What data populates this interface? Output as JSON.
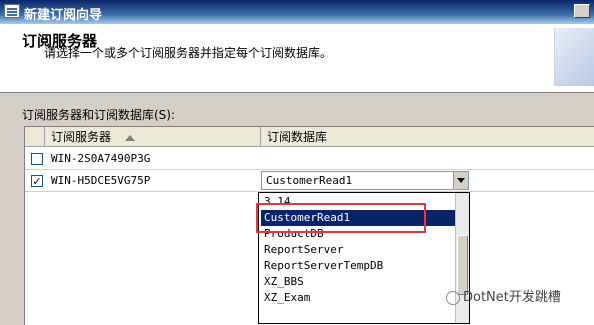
{
  "window": {
    "title": "新建订阅向导"
  },
  "header": {
    "title": "订阅服务器",
    "subtitle": "请选择一个或多个订阅服务器并指定每个订阅数据库。"
  },
  "grid": {
    "label": "订阅服务器和订阅数据库(S):",
    "columns": [
      "订阅服务器",
      "订阅数据库"
    ],
    "rows": [
      {
        "checked": false,
        "server": "WIN-2S0A7490P3G",
        "database": ""
      },
      {
        "checked": true,
        "server": "WIN-H5DCE5VG75P",
        "database": "CustomerRead1"
      }
    ]
  },
  "dropdown": {
    "items": [
      "3.14",
      "CustomerRead1",
      "ProductDB",
      "ReportServer",
      "ReportServerTempDB",
      "XZ_BBS",
      "XZ_Exam"
    ],
    "selected_index": 1
  },
  "watermark": {
    "text": "DotNet开发跳槽"
  },
  "icons": {
    "window": "window-icon",
    "sort": "sort-ascending-icon",
    "dropdown": "chevron-down-icon"
  },
  "colors": {
    "selection": "#0a246a",
    "highlight": "#e03a3a"
  }
}
